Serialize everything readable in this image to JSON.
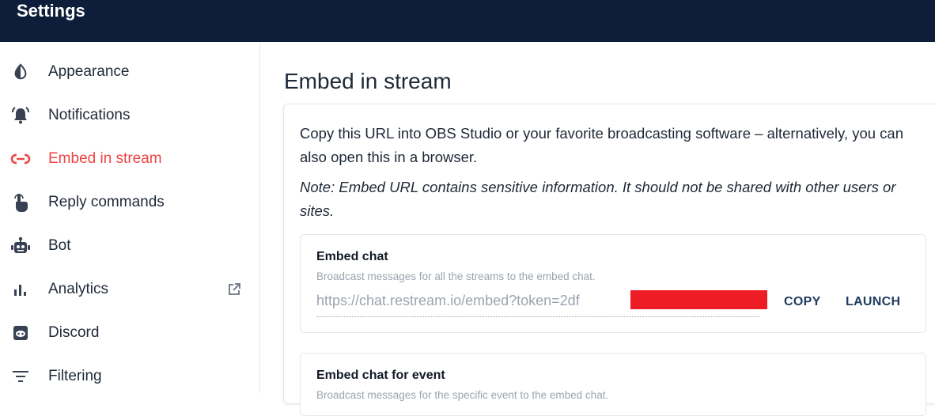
{
  "header": {
    "title": "Settings"
  },
  "sidebar": {
    "items": [
      {
        "label": "Appearance",
        "icon": "half-drop-icon",
        "active": false
      },
      {
        "label": "Notifications",
        "icon": "bell-ringing-icon",
        "active": false
      },
      {
        "label": "Embed in stream",
        "icon": "link-icon",
        "active": true
      },
      {
        "label": "Reply commands",
        "icon": "hand-pointer-icon",
        "active": false
      },
      {
        "label": "Bot",
        "icon": "robot-icon",
        "active": false
      },
      {
        "label": "Analytics",
        "icon": "bar-chart-icon",
        "active": false,
        "external": true
      },
      {
        "label": "Discord",
        "icon": "discord-icon",
        "active": false
      },
      {
        "label": "Filtering",
        "icon": "filter-lines-icon",
        "active": false
      }
    ]
  },
  "main": {
    "title": "Embed in stream",
    "description": "Copy this URL into OBS Studio or your favorite broadcasting software – alternatively, you can also open this in a browser.",
    "note": "Note: Embed URL contains sensitive information. It should not be shared with other users or sites.",
    "embed_chat": {
      "title": "Embed chat",
      "subtitle": "Broadcast messages for all the streams to the embed chat.",
      "url": "https://chat.restream.io/embed?token=2df",
      "copy_label": "COPY",
      "launch_label": "LAUNCH"
    },
    "embed_event": {
      "title": "Embed chat for event",
      "subtitle": "Broadcast messages for the specific event to the embed chat."
    }
  },
  "colors": {
    "header_bg": "#0e1e3a",
    "accent": "#ef4444",
    "redaction": "#ee1c25"
  }
}
